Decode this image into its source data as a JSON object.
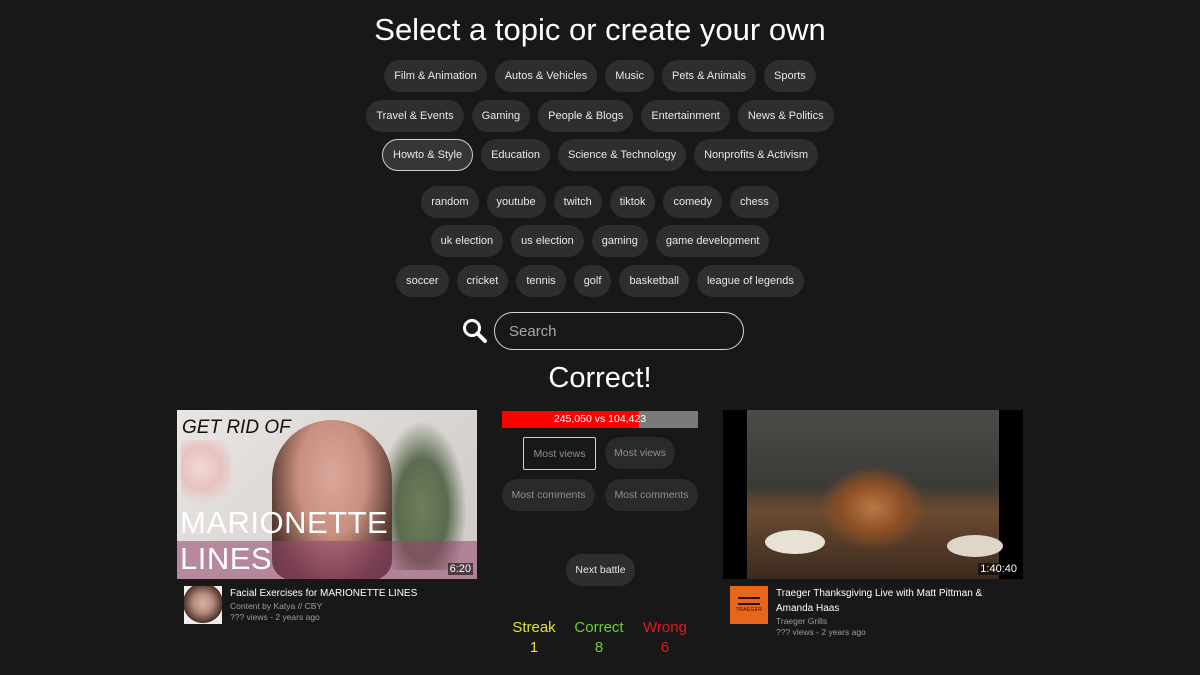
{
  "page_title": "Select a topic or create your own",
  "categories_row1": [
    "Film & Animation",
    "Autos & Vehicles",
    "Music",
    "Pets & Animals",
    "Sports"
  ],
  "categories_row2": [
    "Travel & Events",
    "Gaming",
    "People & Blogs",
    "Entertainment",
    "News & Politics"
  ],
  "categories_row3": [
    "Howto & Style",
    "Education",
    "Science & Technology",
    "Nonprofits & Activism"
  ],
  "selected_category": "Howto & Style",
  "tags_row1": [
    "random",
    "youtube",
    "twitch",
    "tiktok",
    "comedy",
    "chess"
  ],
  "tags_row2": [
    "uk election",
    "us election",
    "gaming",
    "game development"
  ],
  "tags_row3": [
    "soccer",
    "cricket",
    "tennis",
    "golf",
    "basketball",
    "league of legends"
  ],
  "search": {
    "placeholder": "Search",
    "icon": "magnifier-icon"
  },
  "result": "Correct!",
  "battle": {
    "progress_text": "245,050 vs 104,423",
    "progress_fraction": 0.7,
    "progress_color": "#ff0000",
    "progress_track_color": "#7a7a7a",
    "left_views_label": "Most views",
    "right_views_label": "Most views",
    "left_comments_label": "Most comments",
    "right_comments_label": "Most comments",
    "next_label": "Next battle"
  },
  "stats": {
    "streak_label": "Streak",
    "streak_value": "1",
    "streak_color": "#e8e12a",
    "correct_label": "Correct",
    "correct_value": "8",
    "correct_color": "#6ccf2f",
    "wrong_label": "Wrong",
    "wrong_value": "6",
    "wrong_color": "#e01b1b"
  },
  "left_video": {
    "thumb_top_text": "GET RID OF",
    "thumb_big_text": "MARIONETTE LINES",
    "duration": "6:20",
    "title": "Facial Exercises for MARIONETTE LINES",
    "channel": "Content by Katya // CBY",
    "stats": "??? views - 2 years ago"
  },
  "right_video": {
    "duration": "1:40:40",
    "title_line1": "Traeger Thanksgiving Live with Matt Pittman &",
    "title_line2": "Amanda Haas",
    "channel": "Traeger Grills",
    "stats": "??? views - 2 years ago",
    "avatar_text": "TRAEGER"
  }
}
